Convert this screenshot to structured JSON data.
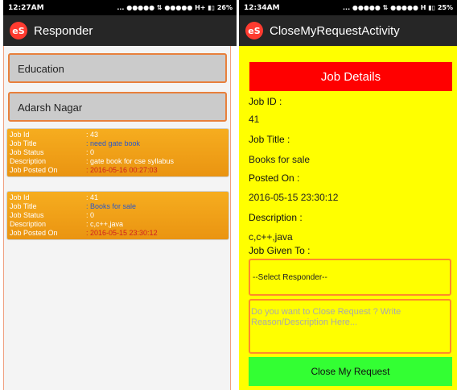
{
  "left": {
    "status": {
      "time": "12:27AM",
      "right": "... ●●●●● ⇅ ●●●●● H+ ▮▯ 26%"
    },
    "app_title": "Responder",
    "logo": "eS",
    "spinner_category": "Education",
    "spinner_location": "Adarsh Nagar",
    "labels": {
      "id": "Job Id",
      "title": "Job Title",
      "status": "Job Status",
      "desc": "Description",
      "posted": "Job Posted On"
    },
    "cards": [
      {
        "id": ": 43",
        "title": ": need gate book",
        "status": ": 0",
        "desc": ": gate book for cse syllabus",
        "posted": ": 2016-05-16 00:27:03"
      },
      {
        "id": ": 41",
        "title": ": Books for sale",
        "status": ": 0",
        "desc": ": c,c++,java",
        "posted": ": 2016-05-15 23:30:12"
      }
    ]
  },
  "right": {
    "status": {
      "time": "12:34AM",
      "right": "... ●●●●● ⇅ ●●●●● H ▮▯ 25%"
    },
    "app_title": "CloseMyRequestActivity",
    "logo": "eS",
    "header": "Job Details",
    "job_id_label": "Job ID :",
    "job_id": "41",
    "job_title_label": "Job Title :",
    "job_title": "Books for sale",
    "posted_label": "Posted On :",
    "posted": "2016-05-15 23:30:12",
    "desc_label": "Description :",
    "desc": "c,c++,java",
    "given_label": "Job Given To :",
    "responder_select": "--Select Responder--",
    "reason_placeholder": "Do you want to Close Request ? Write Reason/Description Here...",
    "close_button": "Close My Request"
  },
  "colors": {
    "card": "#f6ad1f",
    "right_bg": "#ffff00",
    "header_red": "#ff0000",
    "button_green": "#33ff33",
    "accent_orange": "#ff8a2a"
  }
}
